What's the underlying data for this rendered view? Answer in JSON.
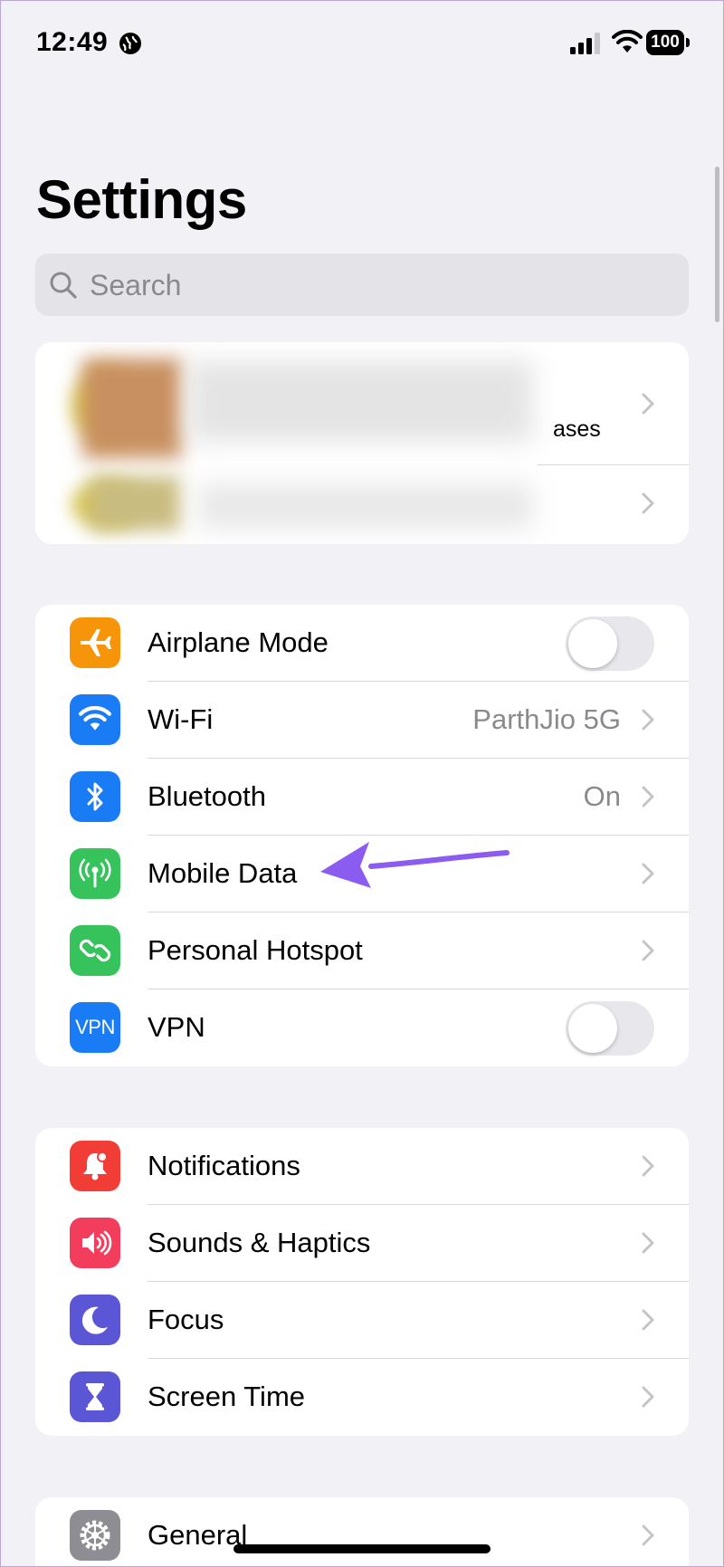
{
  "status_bar": {
    "time": "12:49",
    "battery": "100"
  },
  "header": {
    "title": "Settings"
  },
  "search": {
    "placeholder": "Search"
  },
  "profile_group": {
    "visible_fragment": "ases"
  },
  "connectivity": [
    {
      "label": "Airplane Mode",
      "icon": "airplane-icon",
      "color": "#f7950a",
      "control": "toggle",
      "on": false
    },
    {
      "label": "Wi-Fi",
      "icon": "wifi-icon",
      "color": "#1a7cf5",
      "value": "ParthJio 5G",
      "control": "chevron"
    },
    {
      "label": "Bluetooth",
      "icon": "bluetooth-icon",
      "color": "#1a7cf5",
      "value": "On",
      "control": "chevron"
    },
    {
      "label": "Mobile Data",
      "icon": "antenna-icon",
      "color": "#37c35b",
      "control": "chevron"
    },
    {
      "label": "Personal Hotspot",
      "icon": "hotspot-icon",
      "color": "#37c35b",
      "control": "chevron"
    },
    {
      "label": "VPN",
      "icon": "vpn-icon",
      "icon_text": "VPN",
      "color": "#1a7cf5",
      "control": "toggle",
      "on": false
    }
  ],
  "notifications_group": [
    {
      "label": "Notifications",
      "icon": "bell-icon",
      "color": "#f23d36"
    },
    {
      "label": "Sounds & Haptics",
      "icon": "speaker-icon",
      "color": "#f33d5c"
    },
    {
      "label": "Focus",
      "icon": "moon-icon",
      "color": "#5a56d6"
    },
    {
      "label": "Screen Time",
      "icon": "hourglass-icon",
      "color": "#5a56d6"
    }
  ],
  "general_group": [
    {
      "label": "General",
      "icon": "gear-icon",
      "color": "#8d8d93"
    }
  ],
  "annotation": {
    "arrow_color": "#8a5cf0"
  }
}
